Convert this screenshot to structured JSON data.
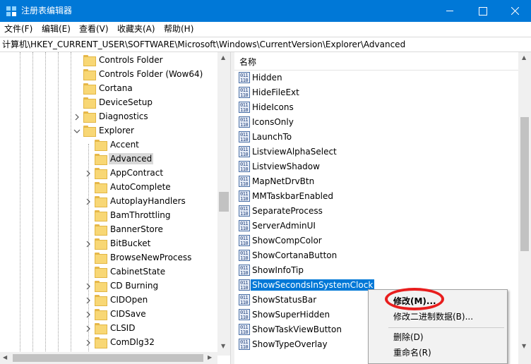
{
  "window": {
    "title": "注册表编辑器"
  },
  "menubar": [
    {
      "label": "文件(F)"
    },
    {
      "label": "编辑(E)"
    },
    {
      "label": "查看(V)"
    },
    {
      "label": "收藏夹(A)"
    },
    {
      "label": "帮助(H)"
    }
  ],
  "address": {
    "path": "计算机\\HKEY_CURRENT_USER\\SOFTWARE\\Microsoft\\Windows\\CurrentVersion\\Explorer\\Advanced"
  },
  "tree": {
    "items": [
      {
        "label": "Controls Folder"
      },
      {
        "label": "Controls Folder (Wow64)"
      },
      {
        "label": "Cortana"
      },
      {
        "label": "DeviceSetup"
      },
      {
        "label": "Diagnostics",
        "expander": "collapsed"
      },
      {
        "label": "Explorer",
        "expander": "expanded"
      },
      {
        "label": "Accent"
      },
      {
        "label": "Advanced",
        "selected": true
      },
      {
        "label": "AppContract",
        "expander": "collapsed"
      },
      {
        "label": "AutoComplete"
      },
      {
        "label": "AutoplayHandlers",
        "expander": "collapsed"
      },
      {
        "label": "BamThrottling"
      },
      {
        "label": "BannerStore"
      },
      {
        "label": "BitBucket",
        "expander": "collapsed"
      },
      {
        "label": "BrowseNewProcess"
      },
      {
        "label": "CabinetState"
      },
      {
        "label": "CD Burning",
        "expander": "collapsed"
      },
      {
        "label": "CIDOpen",
        "expander": "collapsed"
      },
      {
        "label": "CIDSave",
        "expander": "collapsed"
      },
      {
        "label": "CLSID",
        "expander": "collapsed"
      },
      {
        "label": "ComDlg32",
        "expander": "collapsed"
      }
    ]
  },
  "values": {
    "column_name": "名称",
    "items": [
      {
        "name": "Hidden"
      },
      {
        "name": "HideFileExt"
      },
      {
        "name": "HideIcons"
      },
      {
        "name": "IconsOnly"
      },
      {
        "name": "LaunchTo"
      },
      {
        "name": "ListviewAlphaSelect"
      },
      {
        "name": "ListviewShadow"
      },
      {
        "name": "MapNetDrvBtn"
      },
      {
        "name": "MMTaskbarEnabled"
      },
      {
        "name": "SeparateProcess"
      },
      {
        "name": "ServerAdminUI"
      },
      {
        "name": "ShowCompColor"
      },
      {
        "name": "ShowCortanaButton"
      },
      {
        "name": "ShowInfoTip"
      },
      {
        "name": "ShowSecondsInSystemClock",
        "selected": true
      },
      {
        "name": "ShowStatusBar"
      },
      {
        "name": "ShowSuperHidden"
      },
      {
        "name": "ShowTaskViewButton"
      },
      {
        "name": "ShowTypeOverlay"
      }
    ],
    "icon_text": "011\n110"
  },
  "context_menu": {
    "items": [
      {
        "label": "修改(M)...",
        "bold": true
      },
      {
        "label": "修改二进制数据(B)..."
      },
      {
        "label": "删除(D)"
      },
      {
        "label": "重命名(R)"
      }
    ]
  },
  "colors": {
    "titlebar": "#0078d7",
    "selection": "#0078d7",
    "annotation_oval": "#e81e1e"
  }
}
